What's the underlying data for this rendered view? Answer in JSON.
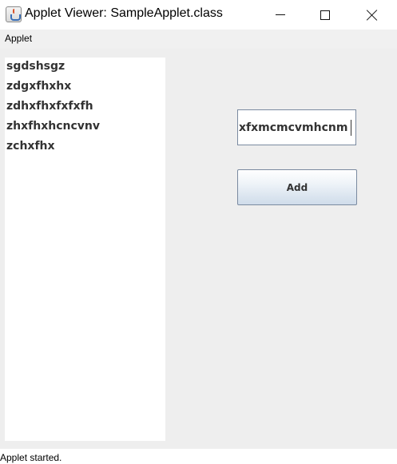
{
  "window": {
    "title": "Applet Viewer: SampleApplet.class"
  },
  "menubar": {
    "items": [
      {
        "label": "Applet"
      }
    ]
  },
  "applet": {
    "list_items": [
      "sgdshsgz",
      "zdgxfhxhx",
      "zdhxfhxfxfxfh",
      "zhxfhxhcncvnv",
      "zchxfhx"
    ],
    "text_field": {
      "value": "xfxmcmcvmhcnm"
    },
    "add_button": {
      "label": "Add"
    }
  },
  "statusbar": {
    "text": "Applet started."
  }
}
